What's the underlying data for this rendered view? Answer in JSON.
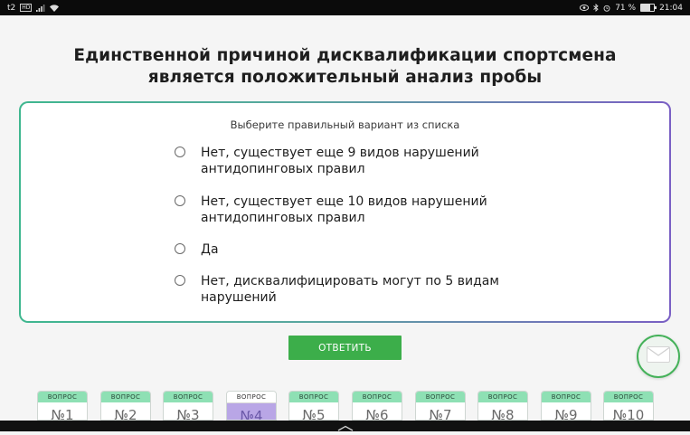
{
  "status_bar": {
    "carrier": "t2",
    "network_badge": "HD",
    "battery_percent": "71 %",
    "time": "21:04",
    "battery_level": 0.71
  },
  "question": {
    "title": "Единственной причиной дисквалификации спортсмена является положительный анализ пробы",
    "hint": "Выберите правильный вариант из списка",
    "options": [
      "Нет, существует еще 9 видов нарушений антидопинговых правил",
      "Нет, существует еще 10 видов нарушений антидопинговых правил",
      "Да",
      "Нет, дисквалифицировать могут по 5 видам нарушений"
    ],
    "answer_label": "ОТВЕТИТЬ"
  },
  "tabs": {
    "items": [
      {
        "head": "ВОПРОС",
        "num": "№1"
      },
      {
        "head": "ВОПРОС",
        "num": "№2"
      },
      {
        "head": "ВОПРОС",
        "num": "№3"
      },
      {
        "head": "ВОПРОС",
        "num": "№4",
        "active": true
      },
      {
        "head": "ВОПРОС",
        "num": "№5"
      },
      {
        "head": "ВОПРОС",
        "num": "№6"
      },
      {
        "head": "ВОПРОС",
        "num": "№7"
      },
      {
        "head": "ВОПРОС",
        "num": "№8"
      },
      {
        "head": "ВОПРОС",
        "num": "№9"
      },
      {
        "head": "ВОПРОС",
        "num": "№10"
      }
    ]
  },
  "colors": {
    "accent_green": "#3cae4a",
    "tab_green": "#8ee0b4",
    "active_purple": "#b9a6e6",
    "border_gradient_start": "#3fb78f",
    "border_gradient_end": "#7a5fc4"
  },
  "icons": [
    "wifi-icon",
    "signal-icon",
    "eye-icon",
    "bluetooth-icon",
    "alarm-icon",
    "battery-icon",
    "mail-icon",
    "chevron-up-icon"
  ]
}
